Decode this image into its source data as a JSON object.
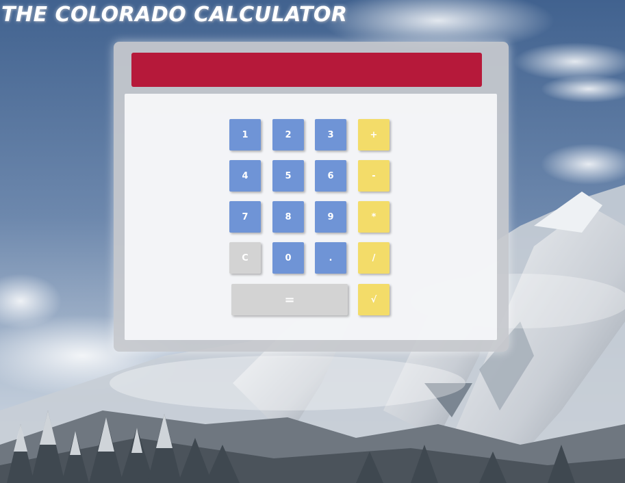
{
  "app": {
    "title": "The Colorado Calculator"
  },
  "display": {
    "value": ""
  },
  "keys": {
    "one": "1",
    "two": "2",
    "three": "3",
    "plus": "+",
    "four": "4",
    "five": "5",
    "six": "6",
    "minus": "-",
    "seven": "7",
    "eight": "8",
    "nine": "9",
    "multiply": "*",
    "clear": "C",
    "zero": "0",
    "decimal": ".",
    "divide": "/",
    "equals": "=",
    "sqrt": "√"
  },
  "colors": {
    "display": "#b6193a",
    "number_key": "#6f94d6",
    "operator_key": "#f3dc69",
    "neutral_key": "#d3d3d3"
  }
}
